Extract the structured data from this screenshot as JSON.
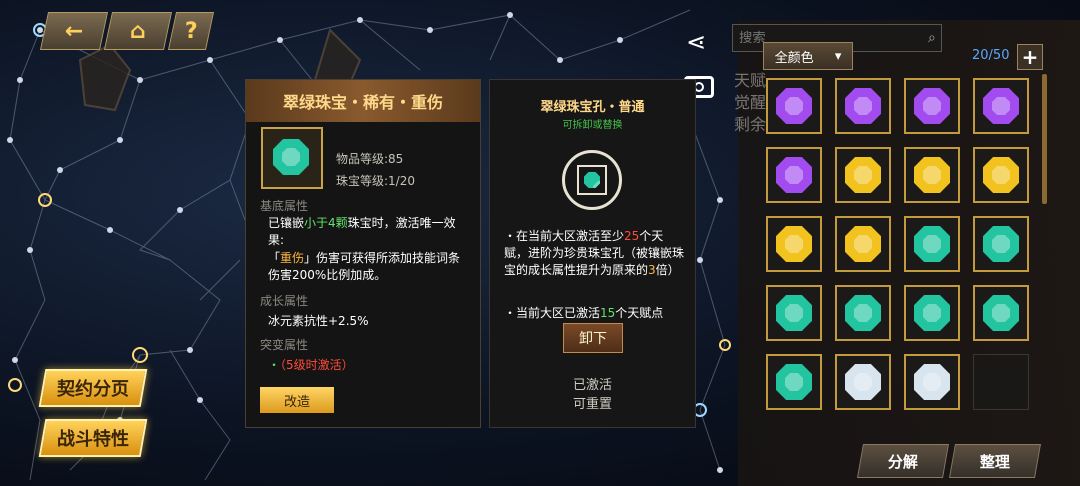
{
  "top_nav": {
    "back_icon": "back-arrow-icon",
    "home_icon": "home-icon",
    "help_label": "?"
  },
  "side_buttons": {
    "contract_page": "契约分页",
    "battle_trait": "战斗特性"
  },
  "detail": {
    "title": "翠绿珠宝・稀有・重伤",
    "item_level": "物品等级:85",
    "gem_level": "珠宝等级:1/20",
    "base_title": "基底属性",
    "base_line1_a": "已镶嵌",
    "base_line1_b": "小于4颗",
    "base_line1_c": "珠宝时，激活唯一效果:",
    "base_line2_a": "「",
    "base_line2_b": "重伤",
    "base_line2_c": "」伤害可获得所添加技能词条伤害200%比例加成。",
    "growth_title": "成长属性",
    "growth_value": "冰元素抗性+2.5%",
    "mutation_title": "突变属性",
    "mutation_bullet": "・",
    "mutation_value": "（5级时激活）",
    "modify_label": "改造"
  },
  "socket": {
    "title": "翠绿珠宝孔・普通",
    "subtitle": "可拆卸或替换",
    "desc1_a": "・在当前大区激活至少",
    "desc1_b": "25",
    "desc1_c": "个天赋，进阶为珍贵珠宝孔（被镶嵌珠宝的成长属性提升为原来的",
    "desc1_d": "3",
    "desc1_e": "倍）",
    "desc2_a": "・当前大区已激活",
    "desc2_b": "15",
    "desc2_c": "个天赋点",
    "unload_label": "卸下",
    "status1": "已激活",
    "status2": "可重置"
  },
  "inventory": {
    "search_placeholder": "搜索",
    "color_filter": "全颜色",
    "count": "20/50",
    "add_label": "+",
    "decompose_label": "分解",
    "sort_label": "整理",
    "slots": [
      "purple",
      "purple",
      "purple",
      "purple",
      "purple",
      "yellow",
      "yellow",
      "yellow",
      "yellow",
      "yellow",
      "green",
      "green",
      "green",
      "green",
      "green",
      "green",
      "green",
      "white",
      "white",
      "empty"
    ]
  },
  "colors": {
    "purple": "#a24cf0",
    "yellow": "#f2c21e",
    "green": "#23c4a0",
    "white": "#d8e4ee",
    "accent": "#ffd15c"
  },
  "background_text": {
    "line1": "天赋",
    "line2": "觉醒",
    "line3": "剩余"
  }
}
